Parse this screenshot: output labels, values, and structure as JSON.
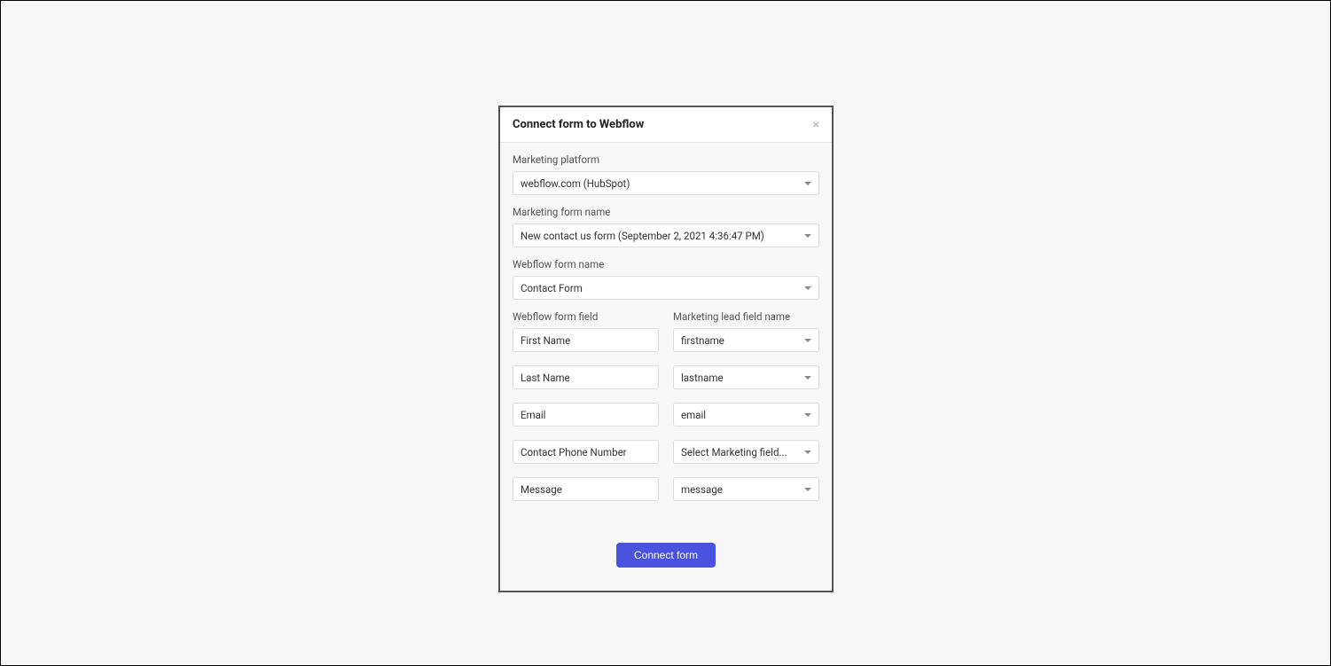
{
  "modal": {
    "title": "Connect form to Webflow",
    "fields": {
      "marketing_platform": {
        "label": "Marketing platform",
        "value": "webflow.com (HubSpot)"
      },
      "marketing_form_name": {
        "label": "Marketing form name",
        "value": "New contact us form (September 2, 2021 4:36:47 PM)"
      },
      "webflow_form_name": {
        "label": "Webflow form name",
        "value": "Contact Form"
      }
    },
    "mapping": {
      "left_label": "Webflow form field",
      "right_label": "Marketing lead field name",
      "rows": [
        {
          "webflow": "First Name",
          "marketing": "firstname"
        },
        {
          "webflow": "Last Name",
          "marketing": "lastname"
        },
        {
          "webflow": "Email",
          "marketing": "email"
        },
        {
          "webflow": "Contact Phone Number",
          "marketing": "Select Marketing field..."
        },
        {
          "webflow": "Message",
          "marketing": "message"
        }
      ]
    },
    "submit_label": "Connect form"
  }
}
